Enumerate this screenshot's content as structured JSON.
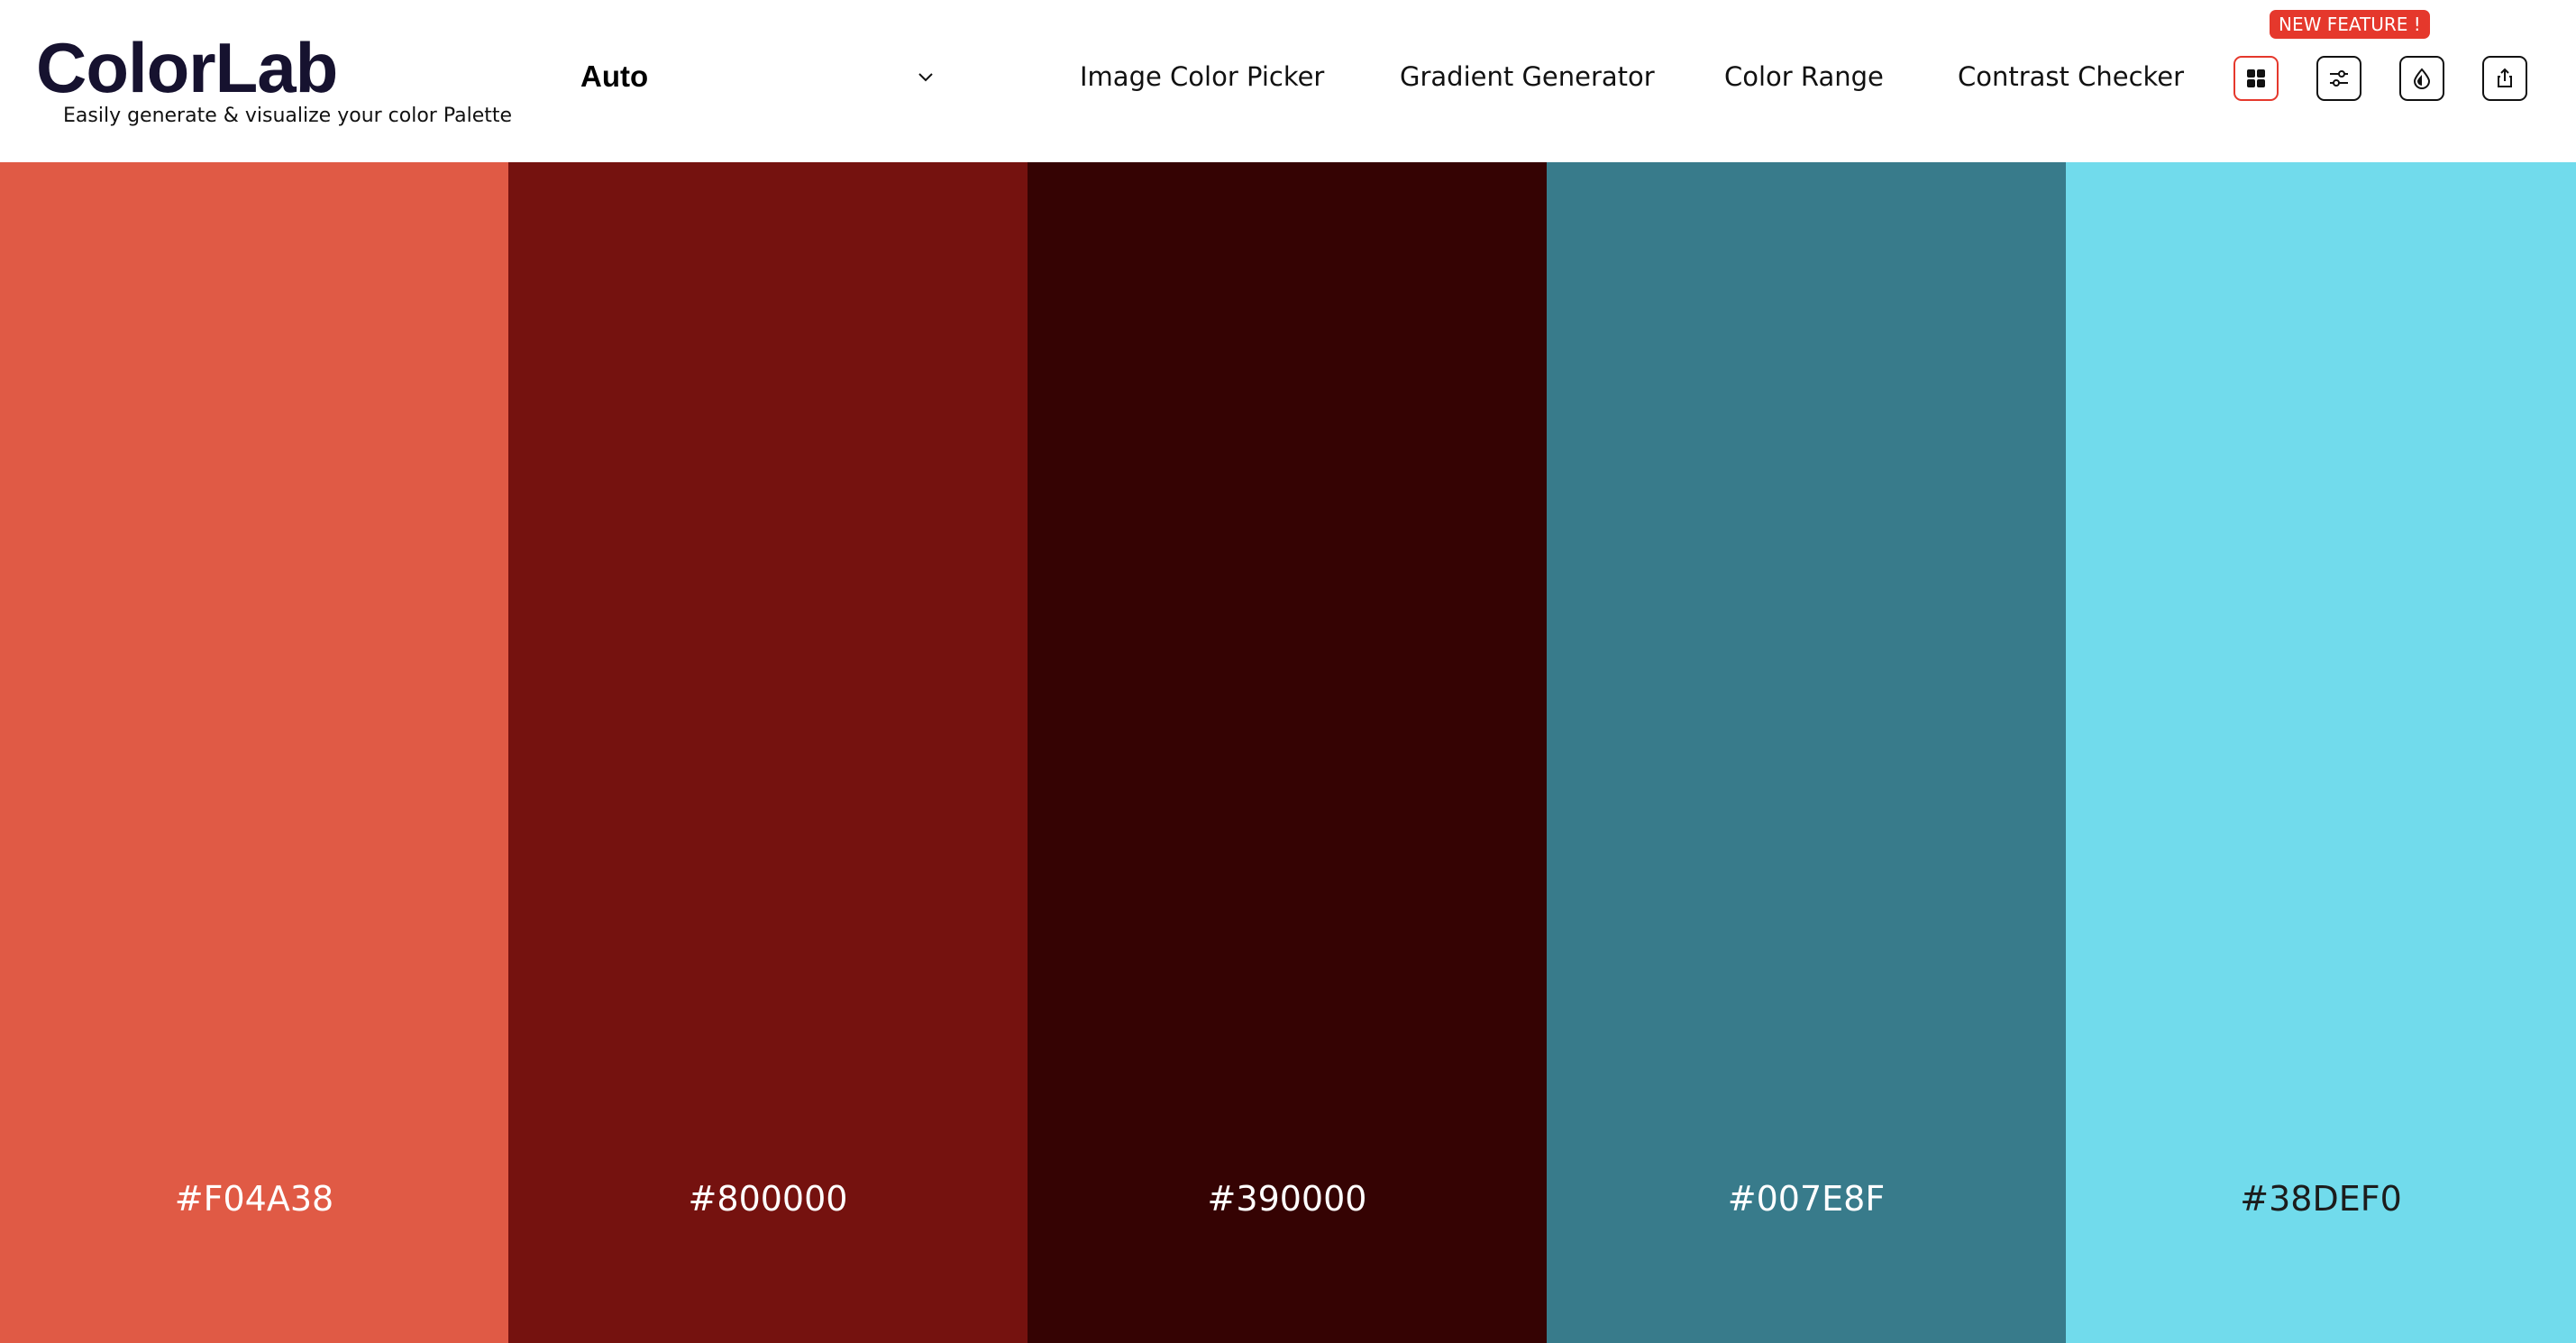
{
  "header": {
    "logo_title": "ColorLab",
    "tagline": "Easily generate & visualize your color Palette",
    "mode_select": {
      "value": "Auto",
      "icon": "chevron-down-icon"
    },
    "nav": [
      {
        "label": "Image Color Picker"
      },
      {
        "label": "Gradient Generator"
      },
      {
        "label": "Color Range"
      },
      {
        "label": "Contrast Checker"
      }
    ],
    "badge": "NEW FEATURE !",
    "icon_buttons": [
      {
        "icon": "layout-grid-icon",
        "active": true
      },
      {
        "icon": "sliders-icon",
        "active": false
      },
      {
        "icon": "drop-icon",
        "active": false
      },
      {
        "icon": "share-icon",
        "active": false
      }
    ],
    "colors": {
      "brand_text": "#16122f",
      "accent": "#e5382c"
    }
  },
  "palette": {
    "swatches": [
      {
        "hex": "#F04A38",
        "display_color": "#e05a45",
        "text_color": "#ffffff"
      },
      {
        "hex": "#800000",
        "display_color": "#75120f",
        "text_color": "#ffffff"
      },
      {
        "hex": "#390000",
        "display_color": "#350303",
        "text_color": "#ffffff"
      },
      {
        "hex": "#007E8F",
        "display_color": "#387b8b",
        "text_color": "#ffffff"
      },
      {
        "hex": "#38DEF0",
        "display_color": "#71dbec",
        "text_color": "#1c1c1c"
      }
    ]
  }
}
